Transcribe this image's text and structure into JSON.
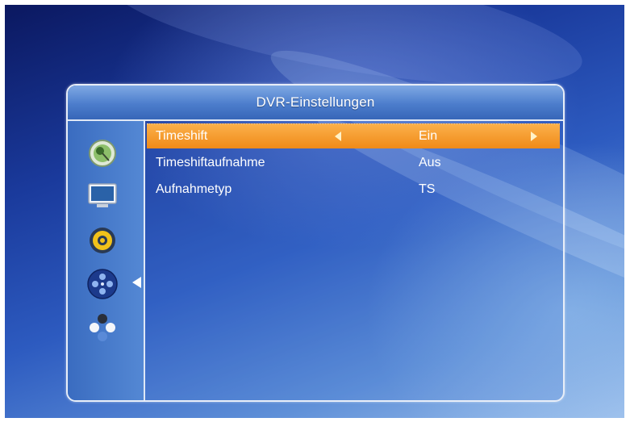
{
  "menu": {
    "title": "DVR-Einstellungen",
    "sidebar_icons": [
      "satellite-dish-icon",
      "monitor-icon",
      "gear-icon",
      "film-reel-icon",
      "molecule-icon"
    ],
    "active_sidebar_index": 3
  },
  "settings": [
    {
      "label": "Timeshift",
      "value": "Ein",
      "selected": true
    },
    {
      "label": "Timeshiftaufnahme",
      "value": "Aus",
      "selected": false
    },
    {
      "label": "Aufnahmetyp",
      "value": "TS",
      "selected": false
    }
  ],
  "colors": {
    "highlight": "#f5961f",
    "panel_border": "#e8eef8",
    "text": "#ffffff"
  }
}
